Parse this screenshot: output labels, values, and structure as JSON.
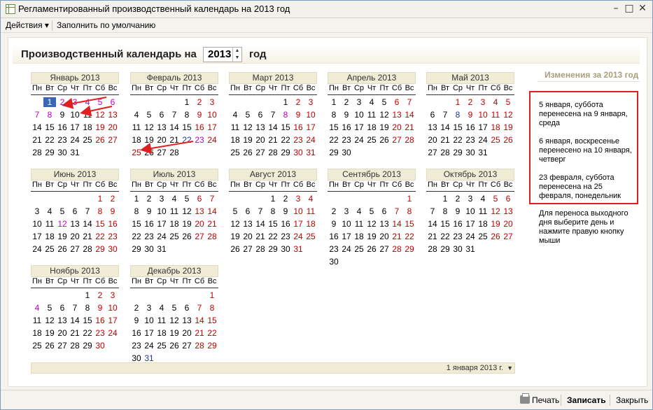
{
  "window": {
    "title": "Регламентированный производственный календарь на 2013 год",
    "minimize": "–",
    "maximize": "□",
    "close": "✕"
  },
  "toolbar": {
    "actions": "Действия ▾",
    "fill_default": "Заполнить по умолчанию"
  },
  "header": {
    "label": "Производственный календарь на",
    "year": "2013",
    "suffix": "год"
  },
  "calendar": {
    "weekdays": [
      "Пн",
      "Вт",
      "Ср",
      "Чт",
      "Пт",
      "Сб",
      "Вс"
    ],
    "months": [
      {
        "name": "Январь 2013",
        "offset": 1,
        "days": 31
      },
      {
        "name": "Февраль 2013",
        "offset": 4,
        "days": 28
      },
      {
        "name": "Март 2013",
        "offset": 4,
        "days": 31
      },
      {
        "name": "Апрель 2013",
        "offset": 0,
        "days": 30
      },
      {
        "name": "Май 2013",
        "offset": 2,
        "days": 31
      },
      {
        "name": "Июнь 2013",
        "offset": 5,
        "days": 30
      },
      {
        "name": "Июль 2013",
        "offset": 0,
        "days": 31
      },
      {
        "name": "Август 2013",
        "offset": 3,
        "days": 31
      },
      {
        "name": "Сентябрь 2013",
        "offset": 6,
        "days": 30
      },
      {
        "name": "Октябрь 2013",
        "offset": 1,
        "days": 31
      },
      {
        "name": "Ноябрь 2013",
        "offset": 4,
        "days": 30
      },
      {
        "name": "Декабрь 2013",
        "offset": 6,
        "days": 31
      }
    ]
  },
  "side": {
    "title": "Изменения за 2013 год",
    "changes": [
      "5 января, суббота перенесена на 9 января, среда",
      "6 января, воскресенье перенесено на 10 января, четверг",
      "23 февраля, суббота перенесена на 25 февраля, понедельник"
    ],
    "hint": "Для переноса выходного дня выберите день и нажмите правую кнопку мыши"
  },
  "footer": {
    "current_date": "1 января 2013 г.",
    "arrow": "▼"
  },
  "bottom": {
    "print": "Печать",
    "save": "Записать",
    "close": "Закрыть"
  },
  "colors": {
    "holiday": "#c00000",
    "moved": "#c000c0",
    "blue": "#2233aa",
    "selected": "#3a66b8",
    "highlight_box": "#e02020"
  }
}
